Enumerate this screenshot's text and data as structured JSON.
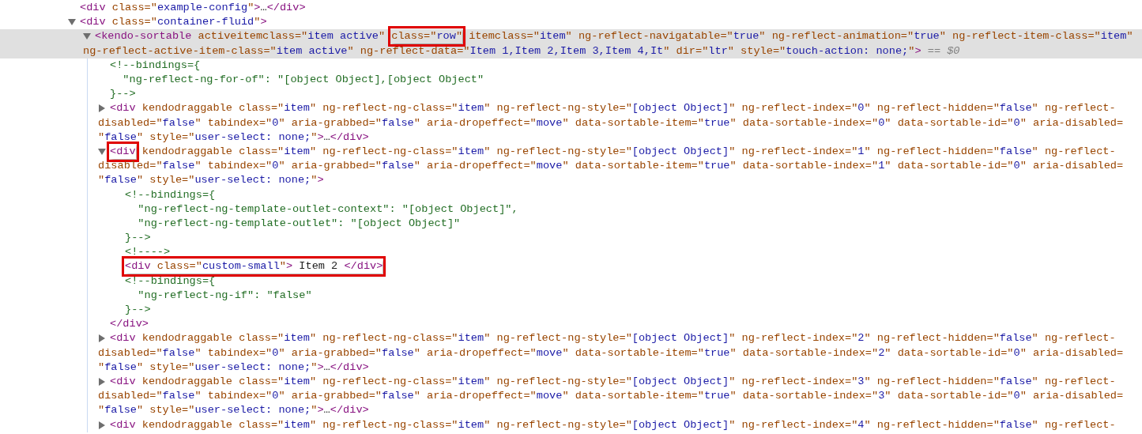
{
  "tree": [
    {
      "kind": "leaf",
      "lines": [
        [
          {
            "kind": "tag",
            "t": "<div"
          },
          {
            "kind": "attr",
            "t": " class=\""
          },
          {
            "kind": "value",
            "t": "example-config"
          },
          {
            "kind": "attr",
            "t": "\""
          },
          {
            "kind": "tag",
            "t": ">"
          },
          {
            "kind": "text",
            "t": "…"
          },
          {
            "kind": "tag",
            "t": "</div>"
          }
        ]
      ]
    },
    {
      "kind": "element",
      "expanded": true,
      "selected": false,
      "lines": [
        [
          {
            "kind": "tag",
            "t": "<div"
          },
          {
            "kind": "attr",
            "t": " class=\""
          },
          {
            "kind": "value",
            "t": "container-fluid"
          },
          {
            "kind": "attr",
            "t": "\""
          },
          {
            "kind": "tag",
            "t": ">"
          }
        ]
      ],
      "children": [
        {
          "kind": "element",
          "expanded": true,
          "selected": true,
          "lines": [
            [
              {
                "kind": "tag",
                "t": "<kendo-sortable"
              },
              {
                "kind": "attr",
                "t": " activeitemclass=\""
              },
              {
                "kind": "value",
                "t": "item active"
              },
              {
                "kind": "attr",
                "t": "\" "
              },
              {
                "kind": "box",
                "parts": [
                  {
                    "kind": "attr",
                    "t": "class=\""
                  },
                  {
                    "kind": "value",
                    "t": "row"
                  },
                  {
                    "kind": "attr",
                    "t": "\""
                  }
                ]
              },
              {
                "kind": "attr",
                "t": " itemclass=\""
              },
              {
                "kind": "value",
                "t": "item"
              },
              {
                "kind": "attr",
                "t": "\" ng-reflect-navigatable=\""
              },
              {
                "kind": "value",
                "t": "true"
              },
              {
                "kind": "attr",
                "t": "\" ng-reflect-animation=\""
              },
              {
                "kind": "value",
                "t": "true"
              },
              {
                "kind": "attr",
                "t": "\" ng-reflect-item-class=\""
              },
              {
                "kind": "value",
                "t": "item"
              },
              {
                "kind": "attr",
                "t": "\""
              }
            ],
            [
              {
                "kind": "attr",
                "t": "ng-reflect-active-item-class=\""
              },
              {
                "kind": "value",
                "t": "item active"
              },
              {
                "kind": "attr",
                "t": "\" ng-reflect-data=\""
              },
              {
                "kind": "value",
                "t": "Item 1,Item 2,Item 3,Item 4,It"
              },
              {
                "kind": "attr",
                "t": "\" dir=\""
              },
              {
                "kind": "value",
                "t": "ltr"
              },
              {
                "kind": "attr",
                "t": "\" style=\""
              },
              {
                "kind": "value",
                "t": "touch-action: none;"
              },
              {
                "kind": "attr",
                "t": "\""
              },
              {
                "kind": "tag",
                "t": ">"
              },
              {
                "kind": "hint",
                "t": " == "
              },
              {
                "kind": "ref",
                "t": "$0"
              }
            ]
          ],
          "children": [
            {
              "kind": "comment",
              "lines": [
                "<!--bindings={",
                "  \"ng-reflect-ng-for-of\": \"[object Object],[object Object\"",
                "}-->"
              ]
            },
            {
              "kind": "element",
              "expanded": false,
              "selected": false,
              "lines": [
                [
                  {
                    "kind": "tag",
                    "t": "<div"
                  },
                  {
                    "kind": "attr",
                    "t": " kendodraggable class=\""
                  },
                  {
                    "kind": "value",
                    "t": "item"
                  },
                  {
                    "kind": "attr",
                    "t": "\" ng-reflect-ng-class=\""
                  },
                  {
                    "kind": "value",
                    "t": "item"
                  },
                  {
                    "kind": "attr",
                    "t": "\" ng-reflect-ng-style=\""
                  },
                  {
                    "kind": "value",
                    "t": "[object Object]"
                  },
                  {
                    "kind": "attr",
                    "t": "\" ng-reflect-index=\""
                  },
                  {
                    "kind": "value",
                    "t": "0"
                  },
                  {
                    "kind": "attr",
                    "t": "\" ng-reflect-hidden=\""
                  },
                  {
                    "kind": "value",
                    "t": "false"
                  },
                  {
                    "kind": "attr",
                    "t": "\" ng-reflect-"
                  }
                ],
                [
                  {
                    "kind": "attr",
                    "t": "disabled=\""
                  },
                  {
                    "kind": "value",
                    "t": "false"
                  },
                  {
                    "kind": "attr",
                    "t": "\" tabindex=\""
                  },
                  {
                    "kind": "value",
                    "t": "0"
                  },
                  {
                    "kind": "attr",
                    "t": "\" aria-grabbed=\""
                  },
                  {
                    "kind": "value",
                    "t": "false"
                  },
                  {
                    "kind": "attr",
                    "t": "\" aria-dropeffect=\""
                  },
                  {
                    "kind": "value",
                    "t": "move"
                  },
                  {
                    "kind": "attr",
                    "t": "\" data-sortable-item=\""
                  },
                  {
                    "kind": "value",
                    "t": "true"
                  },
                  {
                    "kind": "attr",
                    "t": "\" data-sortable-index=\""
                  },
                  {
                    "kind": "value",
                    "t": "0"
                  },
                  {
                    "kind": "attr",
                    "t": "\" data-sortable-id=\""
                  },
                  {
                    "kind": "value",
                    "t": "0"
                  },
                  {
                    "kind": "attr",
                    "t": "\" aria-disabled="
                  }
                ],
                [
                  {
                    "kind": "attr",
                    "t": "\""
                  },
                  {
                    "kind": "value",
                    "t": "false"
                  },
                  {
                    "kind": "attr",
                    "t": "\" style=\""
                  },
                  {
                    "kind": "value",
                    "t": "user-select: none;"
                  },
                  {
                    "kind": "attr",
                    "t": "\""
                  },
                  {
                    "kind": "tag",
                    "t": ">"
                  },
                  {
                    "kind": "text",
                    "t": "…"
                  },
                  {
                    "kind": "tag",
                    "t": "</div>"
                  }
                ]
              ]
            },
            {
              "kind": "element",
              "expanded": true,
              "selected": false,
              "lines": [
                [
                  {
                    "kind": "box",
                    "parts": [
                      {
                        "kind": "tag",
                        "t": "<div"
                      }
                    ]
                  },
                  {
                    "kind": "attr",
                    "t": " kendodraggable class=\""
                  },
                  {
                    "kind": "value",
                    "t": "item"
                  },
                  {
                    "kind": "attr",
                    "t": "\" ng-reflect-ng-class=\""
                  },
                  {
                    "kind": "value",
                    "t": "item"
                  },
                  {
                    "kind": "attr",
                    "t": "\" ng-reflect-ng-style=\""
                  },
                  {
                    "kind": "value",
                    "t": "[object Object]"
                  },
                  {
                    "kind": "attr",
                    "t": "\" ng-reflect-index=\""
                  },
                  {
                    "kind": "value",
                    "t": "1"
                  },
                  {
                    "kind": "attr",
                    "t": "\" ng-reflect-hidden=\""
                  },
                  {
                    "kind": "value",
                    "t": "false"
                  },
                  {
                    "kind": "attr",
                    "t": "\" ng-reflect-"
                  }
                ],
                [
                  {
                    "kind": "attr",
                    "t": "disabled=\""
                  },
                  {
                    "kind": "value",
                    "t": "false"
                  },
                  {
                    "kind": "attr",
                    "t": "\" tabindex=\""
                  },
                  {
                    "kind": "value",
                    "t": "0"
                  },
                  {
                    "kind": "attr",
                    "t": "\" aria-grabbed=\""
                  },
                  {
                    "kind": "value",
                    "t": "false"
                  },
                  {
                    "kind": "attr",
                    "t": "\" aria-dropeffect=\""
                  },
                  {
                    "kind": "value",
                    "t": "move"
                  },
                  {
                    "kind": "attr",
                    "t": "\" data-sortable-item=\""
                  },
                  {
                    "kind": "value",
                    "t": "true"
                  },
                  {
                    "kind": "attr",
                    "t": "\" data-sortable-index=\""
                  },
                  {
                    "kind": "value",
                    "t": "1"
                  },
                  {
                    "kind": "attr",
                    "t": "\" data-sortable-id=\""
                  },
                  {
                    "kind": "value",
                    "t": "0"
                  },
                  {
                    "kind": "attr",
                    "t": "\" aria-disabled="
                  }
                ],
                [
                  {
                    "kind": "attr",
                    "t": "\""
                  },
                  {
                    "kind": "value",
                    "t": "false"
                  },
                  {
                    "kind": "attr",
                    "t": "\" style=\""
                  },
                  {
                    "kind": "value",
                    "t": "user-select: none;"
                  },
                  {
                    "kind": "attr",
                    "t": "\""
                  },
                  {
                    "kind": "tag",
                    "t": ">"
                  }
                ]
              ],
              "children": [
                {
                  "kind": "comment",
                  "lines": [
                    "<!--bindings={",
                    "  \"ng-reflect-ng-template-outlet-context\": \"[object Object]\",",
                    "  \"ng-reflect-ng-template-outlet\": \"[object Object]\"",
                    "}-->"
                  ]
                },
                {
                  "kind": "comment",
                  "lines": [
                    "<!---->"
                  ]
                },
                {
                  "kind": "leaf",
                  "lines": [
                    [
                      {
                        "kind": "box",
                        "parts": [
                          {
                            "kind": "tag",
                            "t": "<div"
                          },
                          {
                            "kind": "attr",
                            "t": " class=\""
                          },
                          {
                            "kind": "value",
                            "t": "custom-small"
                          },
                          {
                            "kind": "attr",
                            "t": "\""
                          },
                          {
                            "kind": "tag",
                            "t": ">"
                          },
                          {
                            "kind": "text",
                            "t": " Item 2 "
                          },
                          {
                            "kind": "tag",
                            "t": "</div>"
                          }
                        ]
                      }
                    ]
                  ]
                },
                {
                  "kind": "comment",
                  "lines": [
                    "<!--bindings={",
                    "  \"ng-reflect-ng-if\": \"false\"",
                    "}-->"
                  ]
                }
              ],
              "close": [
                {
                  "kind": "tag",
                  "t": "</div>"
                }
              ]
            },
            {
              "kind": "element",
              "expanded": false,
              "selected": false,
              "lines": [
                [
                  {
                    "kind": "tag",
                    "t": "<div"
                  },
                  {
                    "kind": "attr",
                    "t": " kendodraggable class=\""
                  },
                  {
                    "kind": "value",
                    "t": "item"
                  },
                  {
                    "kind": "attr",
                    "t": "\" ng-reflect-ng-class=\""
                  },
                  {
                    "kind": "value",
                    "t": "item"
                  },
                  {
                    "kind": "attr",
                    "t": "\" ng-reflect-ng-style=\""
                  },
                  {
                    "kind": "value",
                    "t": "[object Object]"
                  },
                  {
                    "kind": "attr",
                    "t": "\" ng-reflect-index=\""
                  },
                  {
                    "kind": "value",
                    "t": "2"
                  },
                  {
                    "kind": "attr",
                    "t": "\" ng-reflect-hidden=\""
                  },
                  {
                    "kind": "value",
                    "t": "false"
                  },
                  {
                    "kind": "attr",
                    "t": "\" ng-reflect-"
                  }
                ],
                [
                  {
                    "kind": "attr",
                    "t": "disabled=\""
                  },
                  {
                    "kind": "value",
                    "t": "false"
                  },
                  {
                    "kind": "attr",
                    "t": "\" tabindex=\""
                  },
                  {
                    "kind": "value",
                    "t": "0"
                  },
                  {
                    "kind": "attr",
                    "t": "\" aria-grabbed=\""
                  },
                  {
                    "kind": "value",
                    "t": "false"
                  },
                  {
                    "kind": "attr",
                    "t": "\" aria-dropeffect=\""
                  },
                  {
                    "kind": "value",
                    "t": "move"
                  },
                  {
                    "kind": "attr",
                    "t": "\" data-sortable-item=\""
                  },
                  {
                    "kind": "value",
                    "t": "true"
                  },
                  {
                    "kind": "attr",
                    "t": "\" data-sortable-index=\""
                  },
                  {
                    "kind": "value",
                    "t": "2"
                  },
                  {
                    "kind": "attr",
                    "t": "\" data-sortable-id=\""
                  },
                  {
                    "kind": "value",
                    "t": "0"
                  },
                  {
                    "kind": "attr",
                    "t": "\" aria-disabled="
                  }
                ],
                [
                  {
                    "kind": "attr",
                    "t": "\""
                  },
                  {
                    "kind": "value",
                    "t": "false"
                  },
                  {
                    "kind": "attr",
                    "t": "\" style=\""
                  },
                  {
                    "kind": "value",
                    "t": "user-select: none;"
                  },
                  {
                    "kind": "attr",
                    "t": "\""
                  },
                  {
                    "kind": "tag",
                    "t": ">"
                  },
                  {
                    "kind": "text",
                    "t": "…"
                  },
                  {
                    "kind": "tag",
                    "t": "</div>"
                  }
                ]
              ]
            },
            {
              "kind": "element",
              "expanded": false,
              "selected": false,
              "lines": [
                [
                  {
                    "kind": "tag",
                    "t": "<div"
                  },
                  {
                    "kind": "attr",
                    "t": " kendodraggable class=\""
                  },
                  {
                    "kind": "value",
                    "t": "item"
                  },
                  {
                    "kind": "attr",
                    "t": "\" ng-reflect-ng-class=\""
                  },
                  {
                    "kind": "value",
                    "t": "item"
                  },
                  {
                    "kind": "attr",
                    "t": "\" ng-reflect-ng-style=\""
                  },
                  {
                    "kind": "value",
                    "t": "[object Object]"
                  },
                  {
                    "kind": "attr",
                    "t": "\" ng-reflect-index=\""
                  },
                  {
                    "kind": "value",
                    "t": "3"
                  },
                  {
                    "kind": "attr",
                    "t": "\" ng-reflect-hidden=\""
                  },
                  {
                    "kind": "value",
                    "t": "false"
                  },
                  {
                    "kind": "attr",
                    "t": "\" ng-reflect-"
                  }
                ],
                [
                  {
                    "kind": "attr",
                    "t": "disabled=\""
                  },
                  {
                    "kind": "value",
                    "t": "false"
                  },
                  {
                    "kind": "attr",
                    "t": "\" tabindex=\""
                  },
                  {
                    "kind": "value",
                    "t": "0"
                  },
                  {
                    "kind": "attr",
                    "t": "\" aria-grabbed=\""
                  },
                  {
                    "kind": "value",
                    "t": "false"
                  },
                  {
                    "kind": "attr",
                    "t": "\" aria-dropeffect=\""
                  },
                  {
                    "kind": "value",
                    "t": "move"
                  },
                  {
                    "kind": "attr",
                    "t": "\" data-sortable-item=\""
                  },
                  {
                    "kind": "value",
                    "t": "true"
                  },
                  {
                    "kind": "attr",
                    "t": "\" data-sortable-index=\""
                  },
                  {
                    "kind": "value",
                    "t": "3"
                  },
                  {
                    "kind": "attr",
                    "t": "\" data-sortable-id=\""
                  },
                  {
                    "kind": "value",
                    "t": "0"
                  },
                  {
                    "kind": "attr",
                    "t": "\" aria-disabled="
                  }
                ],
                [
                  {
                    "kind": "attr",
                    "t": "\""
                  },
                  {
                    "kind": "value",
                    "t": "false"
                  },
                  {
                    "kind": "attr",
                    "t": "\" style=\""
                  },
                  {
                    "kind": "value",
                    "t": "user-select: none;"
                  },
                  {
                    "kind": "attr",
                    "t": "\""
                  },
                  {
                    "kind": "tag",
                    "t": ">"
                  },
                  {
                    "kind": "text",
                    "t": "…"
                  },
                  {
                    "kind": "tag",
                    "t": "</div>"
                  }
                ]
              ]
            },
            {
              "kind": "element",
              "expanded": false,
              "selected": false,
              "lines": [
                [
                  {
                    "kind": "tag",
                    "t": "<div"
                  },
                  {
                    "kind": "attr",
                    "t": " kendodraggable class=\""
                  },
                  {
                    "kind": "value",
                    "t": "item"
                  },
                  {
                    "kind": "attr",
                    "t": "\" ng-reflect-ng-class=\""
                  },
                  {
                    "kind": "value",
                    "t": "item"
                  },
                  {
                    "kind": "attr",
                    "t": "\" ng-reflect-ng-style=\""
                  },
                  {
                    "kind": "value",
                    "t": "[object Object]"
                  },
                  {
                    "kind": "attr",
                    "t": "\" ng-reflect-index=\""
                  },
                  {
                    "kind": "value",
                    "t": "4"
                  },
                  {
                    "kind": "attr",
                    "t": "\" ng-reflect-hidden=\""
                  },
                  {
                    "kind": "value",
                    "t": "false"
                  },
                  {
                    "kind": "attr",
                    "t": "\" ng-reflect-"
                  }
                ]
              ]
            }
          ]
        }
      ]
    }
  ]
}
